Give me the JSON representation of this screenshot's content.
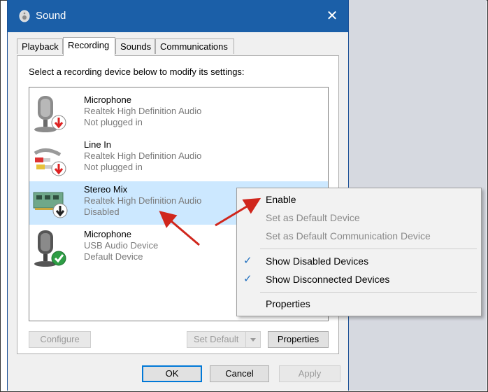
{
  "window": {
    "title": "Sound",
    "close_glyph": "✕"
  },
  "tabs": [
    {
      "label": "Playback"
    },
    {
      "label": "Recording"
    },
    {
      "label": "Sounds"
    },
    {
      "label": "Communications"
    }
  ],
  "instruction": "Select a recording device below to modify its settings:",
  "devices": [
    {
      "name": "Microphone",
      "driver": "Realtek High Definition Audio",
      "status": "Not plugged in",
      "icon": "microphone-icon",
      "badge": "red-down-arrow"
    },
    {
      "name": "Line In",
      "driver": "Realtek High Definition Audio",
      "status": "Not plugged in",
      "icon": "line-in-cable-icon",
      "badge": "red-down-arrow"
    },
    {
      "name": "Stereo Mix",
      "driver": "Realtek High Definition Audio",
      "status": "Disabled",
      "icon": "sound-card-icon",
      "badge": "black-down-arrow"
    },
    {
      "name": "Microphone",
      "driver": "USB Audio Device",
      "status": "Default Device",
      "icon": "microphone-icon",
      "badge": "green-check"
    }
  ],
  "buttons": {
    "configure": "Configure",
    "set_default": "Set Default",
    "properties": "Properties",
    "ok": "OK",
    "cancel": "Cancel",
    "apply": "Apply"
  },
  "context_menu": {
    "items": [
      {
        "label": "Enable",
        "enabled": true,
        "checked": false
      },
      {
        "label": "Set as Default Device",
        "enabled": false,
        "checked": false
      },
      {
        "label": "Set as Default Communication Device",
        "enabled": false,
        "checked": false
      },
      {
        "label": "Show Disabled Devices",
        "enabled": true,
        "checked": true
      },
      {
        "label": "Show Disconnected Devices",
        "enabled": true,
        "checked": true
      },
      {
        "label": "Properties",
        "enabled": true,
        "checked": false
      }
    ],
    "check_glyph": "✓"
  },
  "colors": {
    "titlebar": "#1b5fa8",
    "selection": "#cce8ff",
    "annotation_arrow": "#d0261c",
    "default_button_border": "#0078d7"
  }
}
